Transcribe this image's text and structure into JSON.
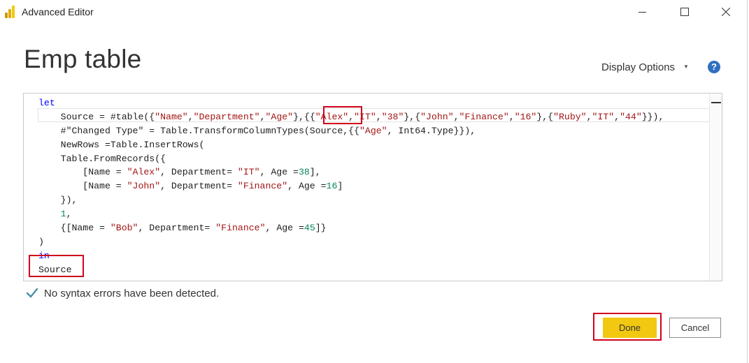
{
  "window": {
    "title": "Advanced Editor",
    "app_icon": "power-bi-icon",
    "controls": [
      "minimize-icon",
      "maximize-icon",
      "close-icon"
    ]
  },
  "header": {
    "query_name": "Emp table",
    "display_options_label": "Display Options",
    "display_options_caret": "▼",
    "help_icon": "?"
  },
  "editor": {
    "lines": [
      [
        {
          "t": "let",
          "c": "kw"
        }
      ],
      [
        {
          "t": "    Source = #table({"
        },
        {
          "t": "\"Name\"",
          "c": "str"
        },
        {
          "t": ","
        },
        {
          "t": "\"Department\"",
          "c": "str"
        },
        {
          "t": ","
        },
        {
          "t": "\"Age\"",
          "c": "str"
        },
        {
          "t": "},{{"
        },
        {
          "t": "\"Alex\"",
          "c": "str"
        },
        {
          "t": ","
        },
        {
          "t": "\"IT\"",
          "c": "str"
        },
        {
          "t": ","
        },
        {
          "t": "\"38\"",
          "c": "str"
        },
        {
          "t": "},{"
        },
        {
          "t": "\"John\"",
          "c": "str"
        },
        {
          "t": ","
        },
        {
          "t": "\"Finance\"",
          "c": "str"
        },
        {
          "t": ","
        },
        {
          "t": "\"16\"",
          "c": "str"
        },
        {
          "t": "},{"
        },
        {
          "t": "\"Ruby\"",
          "c": "str"
        },
        {
          "t": ","
        },
        {
          "t": "\"IT\"",
          "c": "str"
        },
        {
          "t": ","
        },
        {
          "t": "\"44\"",
          "c": "str"
        },
        {
          "t": "}}),"
        }
      ],
      [
        {
          "t": "    #\"Changed Type\" = Table.TransformColumnTypes(Source,{{"
        },
        {
          "t": "\"Age\"",
          "c": "str"
        },
        {
          "t": ", Int64.Type}}),"
        }
      ],
      [
        {
          "t": "    NewRows =Table.InsertRows("
        }
      ],
      [
        {
          "t": "    Table.FromRecords({"
        }
      ],
      [
        {
          "t": "        [Name = "
        },
        {
          "t": "\"Alex\"",
          "c": "str"
        },
        {
          "t": ", Department= "
        },
        {
          "t": "\"IT\"",
          "c": "str"
        },
        {
          "t": ", Age ="
        },
        {
          "t": "38",
          "c": "num"
        },
        {
          "t": "],"
        }
      ],
      [
        {
          "t": "        [Name = "
        },
        {
          "t": "\"John\"",
          "c": "str"
        },
        {
          "t": ", Department= "
        },
        {
          "t": "\"Finance\"",
          "c": "str"
        },
        {
          "t": ", Age ="
        },
        {
          "t": "16",
          "c": "num"
        },
        {
          "t": "]"
        }
      ],
      [
        {
          "t": "    }),"
        }
      ],
      [
        {
          "t": "    "
        },
        {
          "t": "1",
          "c": "num"
        },
        {
          "t": ","
        }
      ],
      [
        {
          "t": "    {[Name = "
        },
        {
          "t": "\"Bob\"",
          "c": "str"
        },
        {
          "t": ", Department= "
        },
        {
          "t": "\"Finance\"",
          "c": "str"
        },
        {
          "t": ", Age ="
        },
        {
          "t": "45",
          "c": "num"
        },
        {
          "t": "]}"
        }
      ],
      [
        {
          "t": ")"
        }
      ],
      [
        {
          "t": "in",
          "c": "kw"
        }
      ],
      [
        {
          "t": "Source"
        }
      ]
    ]
  },
  "status": {
    "icon": "checkmark-icon",
    "message": "No syntax errors have been detected."
  },
  "buttons": {
    "done_label": "Done",
    "cancel_label": "Cancel"
  },
  "colors": {
    "keyword": "#0000ff",
    "string": "#a31515",
    "number": "#098658",
    "done_button": "#f2c811",
    "annotation": "#d0021b",
    "help_icon": "#2f6fbf"
  }
}
